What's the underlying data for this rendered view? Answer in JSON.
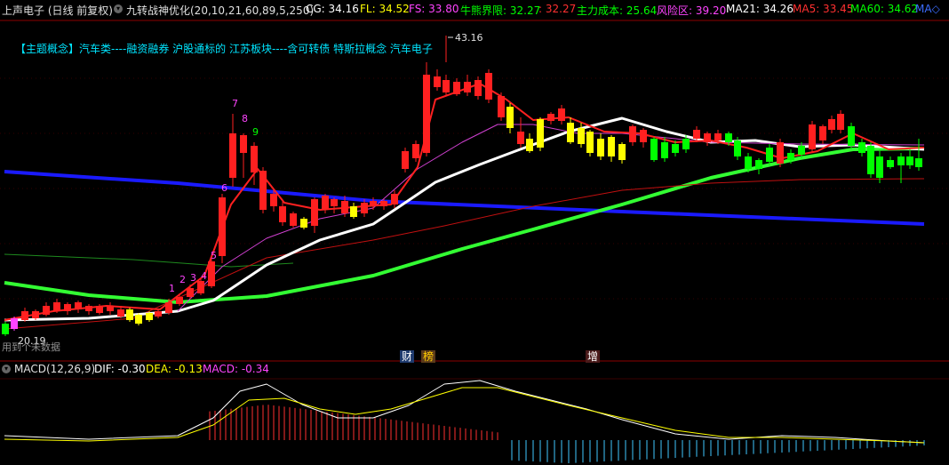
{
  "header": {
    "stock_title": "上声电子 (日线 前复权)",
    "indicator_name": "九转战神优化(20,10,21,60,89,5,250)",
    "items": [
      {
        "label": "CG: 34.16",
        "color": "#ffffff"
      },
      {
        "label": "FL: 34.52",
        "color": "#ffff00"
      },
      {
        "label": "FS: 33.80",
        "color": "#ff44ff"
      },
      {
        "label": "牛熊界限: 32.27",
        "color": "#00ff00"
      },
      {
        "label": ": 32.27",
        "color": "#ff3030"
      },
      {
        "label": "主力成本: 25.64",
        "color": "#00ff00"
      },
      {
        "label": "风险区: 39.20",
        "color": "#ff44ff"
      },
      {
        "label": "MA21: 34.26",
        "color": "#ffffff"
      },
      {
        "label": "MA5: 33.45",
        "color": "#ff3030"
      },
      {
        "label": "MA60: 34.62",
        "color": "#00ff00"
      },
      {
        "label": "MA◇",
        "color": "#3b6cff"
      }
    ]
  },
  "concept_text": "【主题概念】汽车类----融资融券 沪股通标的 江苏板块----含可转债 特斯拉概念 汽车电子",
  "price_labels": {
    "high": "43.16",
    "low": "20.19"
  },
  "low_data_note": "用到个未数据",
  "event_tags": [
    {
      "label": "财",
      "bg": "#1e3a6e",
      "color": "#ffffff"
    },
    {
      "label": "榜",
      "bg": "#5a3a1a",
      "color": "#ffcc00"
    },
    {
      "label": "增",
      "bg": "#4a1a1a",
      "color": "#ffffff"
    }
  ],
  "nine_turn_labels": [
    "1",
    "2",
    "3",
    "4",
    "5",
    "6",
    "7",
    "8",
    "9"
  ],
  "macd_header": {
    "name": "MACD(12,26,9)",
    "dif": "DIF: -0.30",
    "dea": "DEA: -0.13",
    "macd": "MACD: -0.34"
  },
  "colors": {
    "up": "#ff2020",
    "down": "#00ff00",
    "warn": "#ffff00",
    "magenta": "#ff44ff",
    "white": "#ffffff",
    "blue": "#1a1aff",
    "green": "#33ff33"
  }
}
